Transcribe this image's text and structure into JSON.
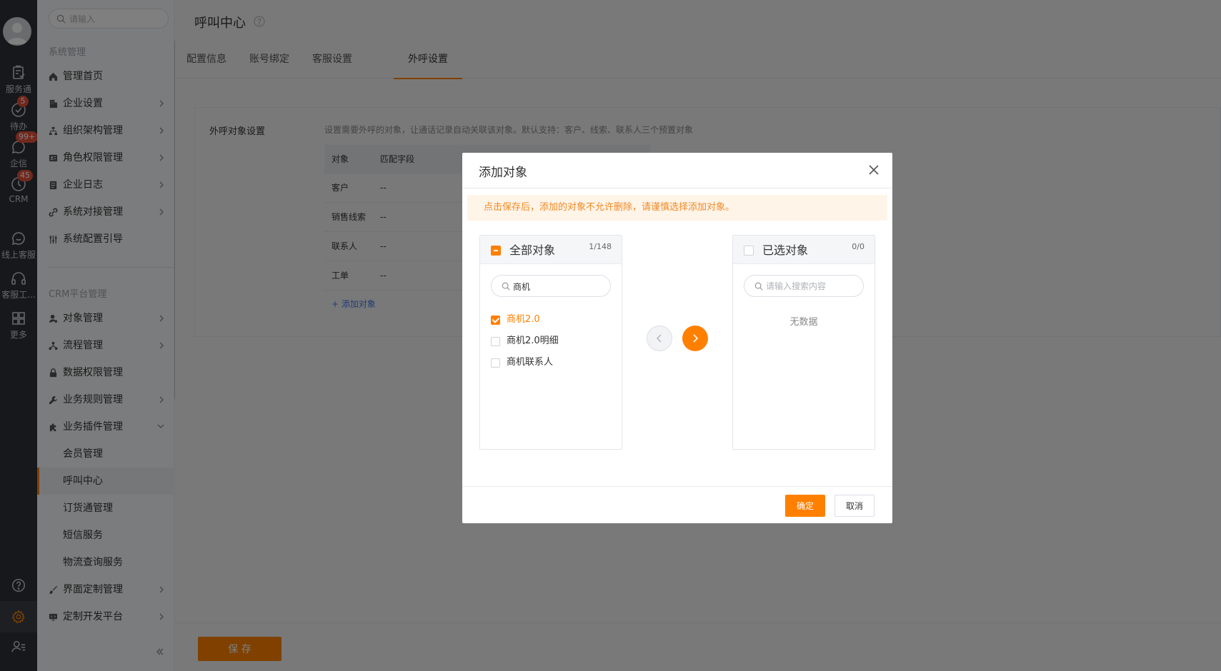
{
  "rail": {
    "items": [
      {
        "label": "服务通",
        "icon": "clipboard-icon",
        "badge": ""
      },
      {
        "label": "待办",
        "icon": "check-circle-icon",
        "badge": "5"
      },
      {
        "label": "企信",
        "icon": "chat-icon",
        "badge": "99+"
      },
      {
        "label": "CRM",
        "icon": "clock-icon",
        "badge": "45"
      },
      {
        "label": "线上客服",
        "icon": "chat-smile-icon",
        "badge": ""
      },
      {
        "label": "客服工...",
        "icon": "headset-icon",
        "badge": ""
      },
      {
        "label": "更多",
        "icon": "grid-icon",
        "badge": ""
      }
    ],
    "bottom": [
      "help-icon",
      "gear-icon",
      "user-list-icon"
    ]
  },
  "sidebar": {
    "search_placeholder": "请输入",
    "group1": "系统管理",
    "group1_items": [
      {
        "label": "管理首页",
        "expand": false
      },
      {
        "label": "企业设置",
        "expand": true
      },
      {
        "label": "组织架构管理",
        "expand": true
      },
      {
        "label": "角色权限管理",
        "expand": true
      },
      {
        "label": "企业日志",
        "expand": true
      },
      {
        "label": "系统对接管理",
        "expand": true
      },
      {
        "label": "系统配置引导",
        "expand": false
      }
    ],
    "group2": "CRM平台管理",
    "group2_items": [
      {
        "label": "对象管理",
        "expand": true
      },
      {
        "label": "流程管理",
        "expand": true
      },
      {
        "label": "数据权限管理",
        "expand": false
      },
      {
        "label": "业务规则管理",
        "expand": true
      },
      {
        "label": "业务插件管理",
        "expand": true
      }
    ],
    "sub_items": [
      "会员管理",
      "呼叫中心",
      "订货通管理",
      "短信服务",
      "物流查询服务"
    ],
    "group3_items": [
      {
        "label": "界面定制管理",
        "expand": true
      },
      {
        "label": "定制开发平台",
        "expand": true
      }
    ],
    "collapse": "«"
  },
  "main": {
    "title": "呼叫中心",
    "tabs": [
      "配置信息",
      "账号绑定",
      "客服设置",
      "外呼设置"
    ],
    "active_tab": 3,
    "section_label": "外呼对象设置",
    "section_hint": "设置需要外呼的对象，让通话记录自动关联该对象。默认支持：客户、线索、联系人三个预置对象",
    "table_headers": [
      "对象",
      "匹配字段"
    ],
    "table_rows": [
      [
        "客户",
        "--"
      ],
      [
        "销售线索",
        "--"
      ],
      [
        "联系人",
        "--"
      ],
      [
        "工单",
        "--"
      ]
    ],
    "add_link": "+ 添加对象",
    "save": "保 存"
  },
  "dialog": {
    "title": "添加对象",
    "notice": "点击保存后，添加的对象不允许删除，请谨慎选择添加对象。",
    "left": {
      "title": "全部对象",
      "count": "1/148",
      "search_value": "商机",
      "items": [
        {
          "label": "商机2.0",
          "checked": true
        },
        {
          "label": "商机2.0明细",
          "checked": false
        },
        {
          "label": "商机联系人",
          "checked": false
        }
      ]
    },
    "right": {
      "title": "已选对象",
      "count": "0/0",
      "search_placeholder": "请输入搜索内容",
      "empty": "无数据"
    },
    "ok": "确定",
    "cancel": "取消"
  },
  "colors": {
    "accent": "#ff8000",
    "rail": "#2d3036",
    "badge": "#e5503b",
    "link": "#3c7be7"
  }
}
